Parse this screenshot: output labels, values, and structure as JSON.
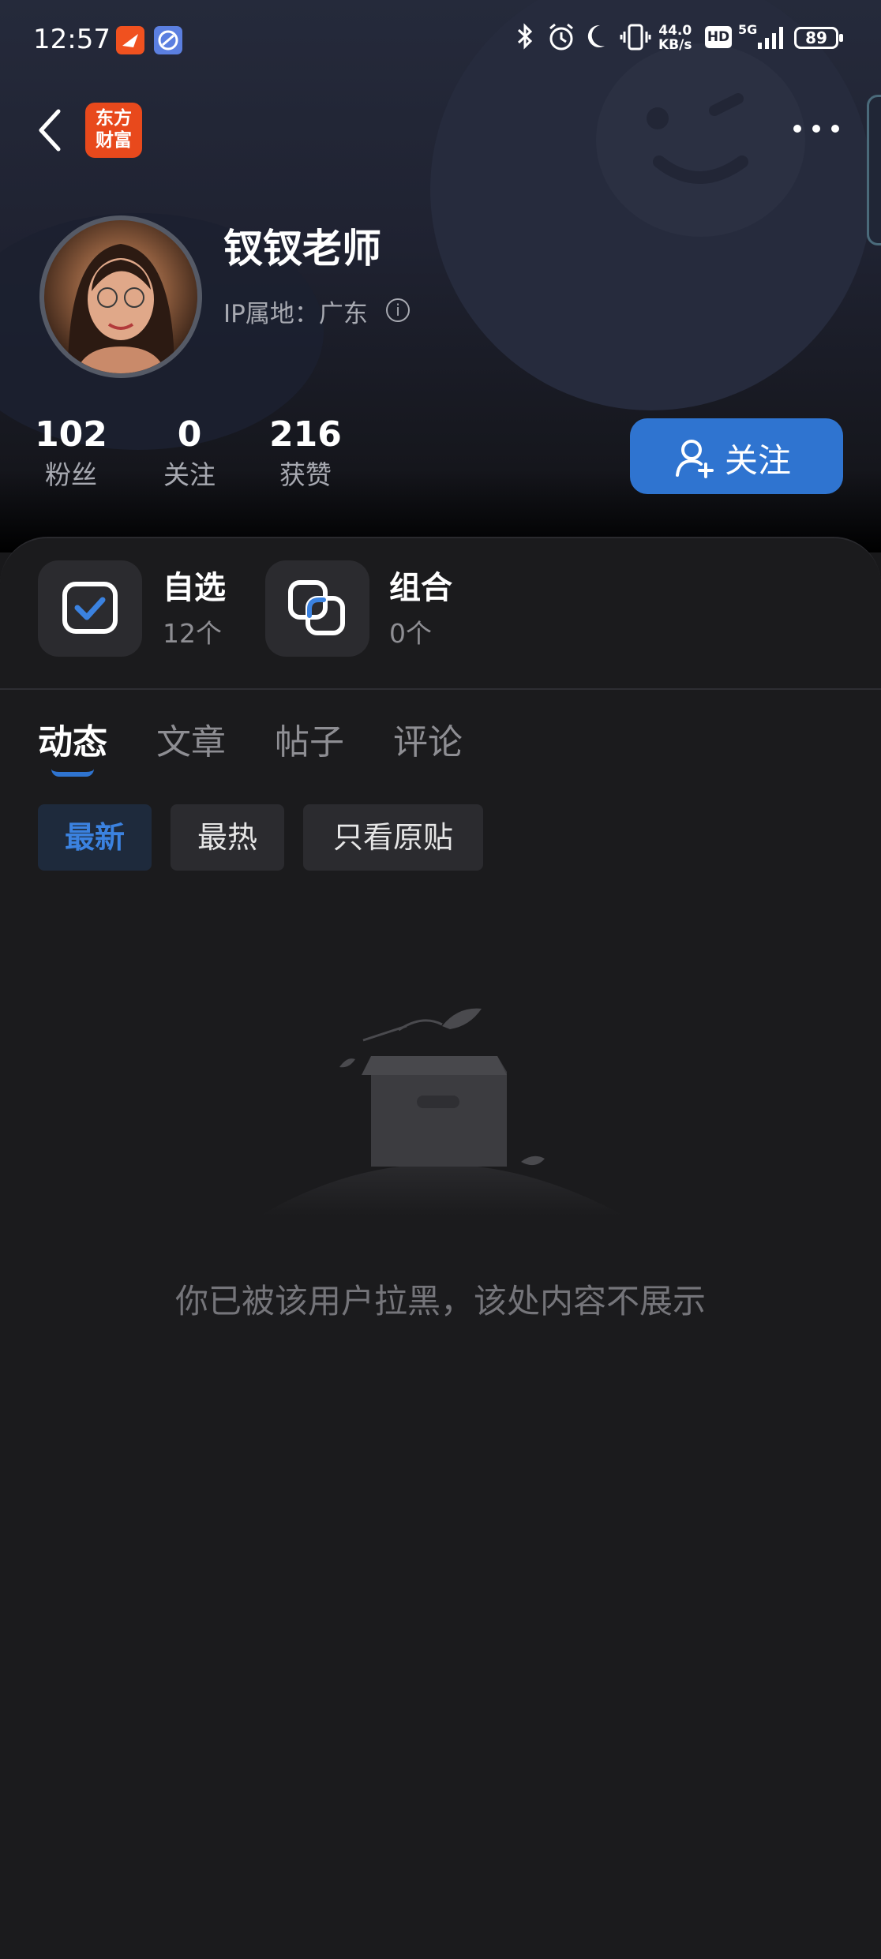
{
  "status_bar": {
    "time": "12:57",
    "net_speed_value": "44.0",
    "net_speed_unit": "KB/s",
    "hd": "HD",
    "network": "5G",
    "battery": "89"
  },
  "header": {
    "logo_line1": "东方",
    "logo_line2": "财富",
    "username": "钗钗老师",
    "ip_location": "IP属地：广东"
  },
  "stats": [
    {
      "value": "102",
      "label": "粉丝"
    },
    {
      "value": "0",
      "label": "关注"
    },
    {
      "value": "216",
      "label": "获赞"
    }
  ],
  "follow_button": {
    "label": "关注"
  },
  "quick_access": [
    {
      "title": "自选",
      "count": "12个"
    },
    {
      "title": "组合",
      "count": "0个"
    }
  ],
  "tabs": [
    {
      "label": "动态",
      "active": true
    },
    {
      "label": "文章",
      "active": false
    },
    {
      "label": "帖子",
      "active": false
    },
    {
      "label": "评论",
      "active": false
    }
  ],
  "filters": [
    {
      "label": "最新",
      "active": true
    },
    {
      "label": "最热",
      "active": false
    },
    {
      "label": "只看原贴",
      "active": false
    }
  ],
  "empty_state": {
    "message": "你已被该用户拉黑，该处内容不展示"
  },
  "colors": {
    "accent": "#2f74d0",
    "background": "#19191b",
    "logo": "#e8491c"
  }
}
